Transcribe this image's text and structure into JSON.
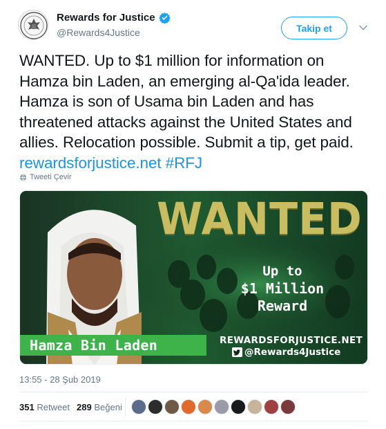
{
  "account": {
    "display_name": "Rewards for Justice",
    "handle": "@Rewards4Justice",
    "verified": true,
    "avatar_icon": "us-department-of-state-seal-icon"
  },
  "follow_button": {
    "label": "Takip et"
  },
  "tweet": {
    "text": "WANTED. Up to $1 million for information on Hamza bin Laden, an emerging al-Qa'ida leader. Hamza is son of Usama bin Laden and has threatened attacks against the United States and allies. Relocation possible. Submit a tip, get paid.",
    "link": "rewardsforjustice.net",
    "hashtag": "#RFJ",
    "translate_label": "Tweeti Çevir"
  },
  "media": {
    "headline": "WANTED",
    "reward_line1": "Up to",
    "reward_line2": "$1 Million",
    "reward_line3": "Reward",
    "person_name": "Hamza Bin Laden",
    "site": "REWARDSFORJUSTICE.NET",
    "twitter_handle": "@Rewards4Justice"
  },
  "meta": {
    "timestamp": "13:55 - 28 Şub 2019"
  },
  "stats": {
    "retweet_count": "351",
    "retweet_label": "Retweet",
    "like_count": "289",
    "like_label": "Beğeni"
  },
  "colors": {
    "accent": "#1da1f2",
    "link": "#1b95e0",
    "banner_green": "#3db34a",
    "wanted_gold": "#c9bd62"
  }
}
